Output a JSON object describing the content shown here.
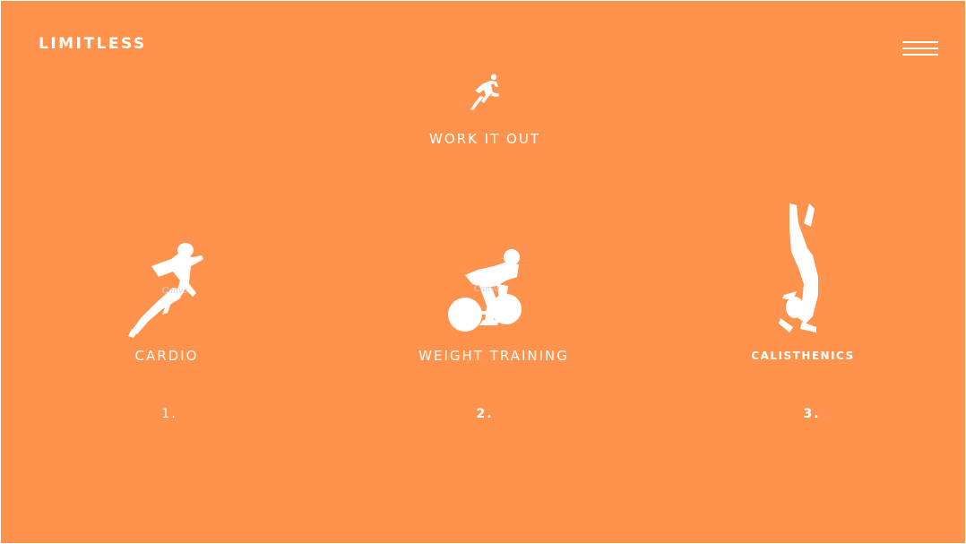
{
  "header": {
    "brand": "LIMITLESS",
    "menu_icon": "hamburger-menu-icon"
  },
  "hero": {
    "icon": "runner-icon",
    "title": "WORK IT OUT"
  },
  "categories": [
    {
      "label": "CARDIO",
      "number": "1.",
      "icon": "running-woman-icon",
      "watermark": "Canva"
    },
    {
      "label": "WEIGHT TRAINING",
      "number": "2.",
      "icon": "weightlifter-icon",
      "watermark": "Canva"
    },
    {
      "label": "CALISTHENICS",
      "number": "3.",
      "icon": "handstand-icon"
    }
  ],
  "colors": {
    "background": "#FF924C",
    "foreground": "#FFFFFF"
  }
}
